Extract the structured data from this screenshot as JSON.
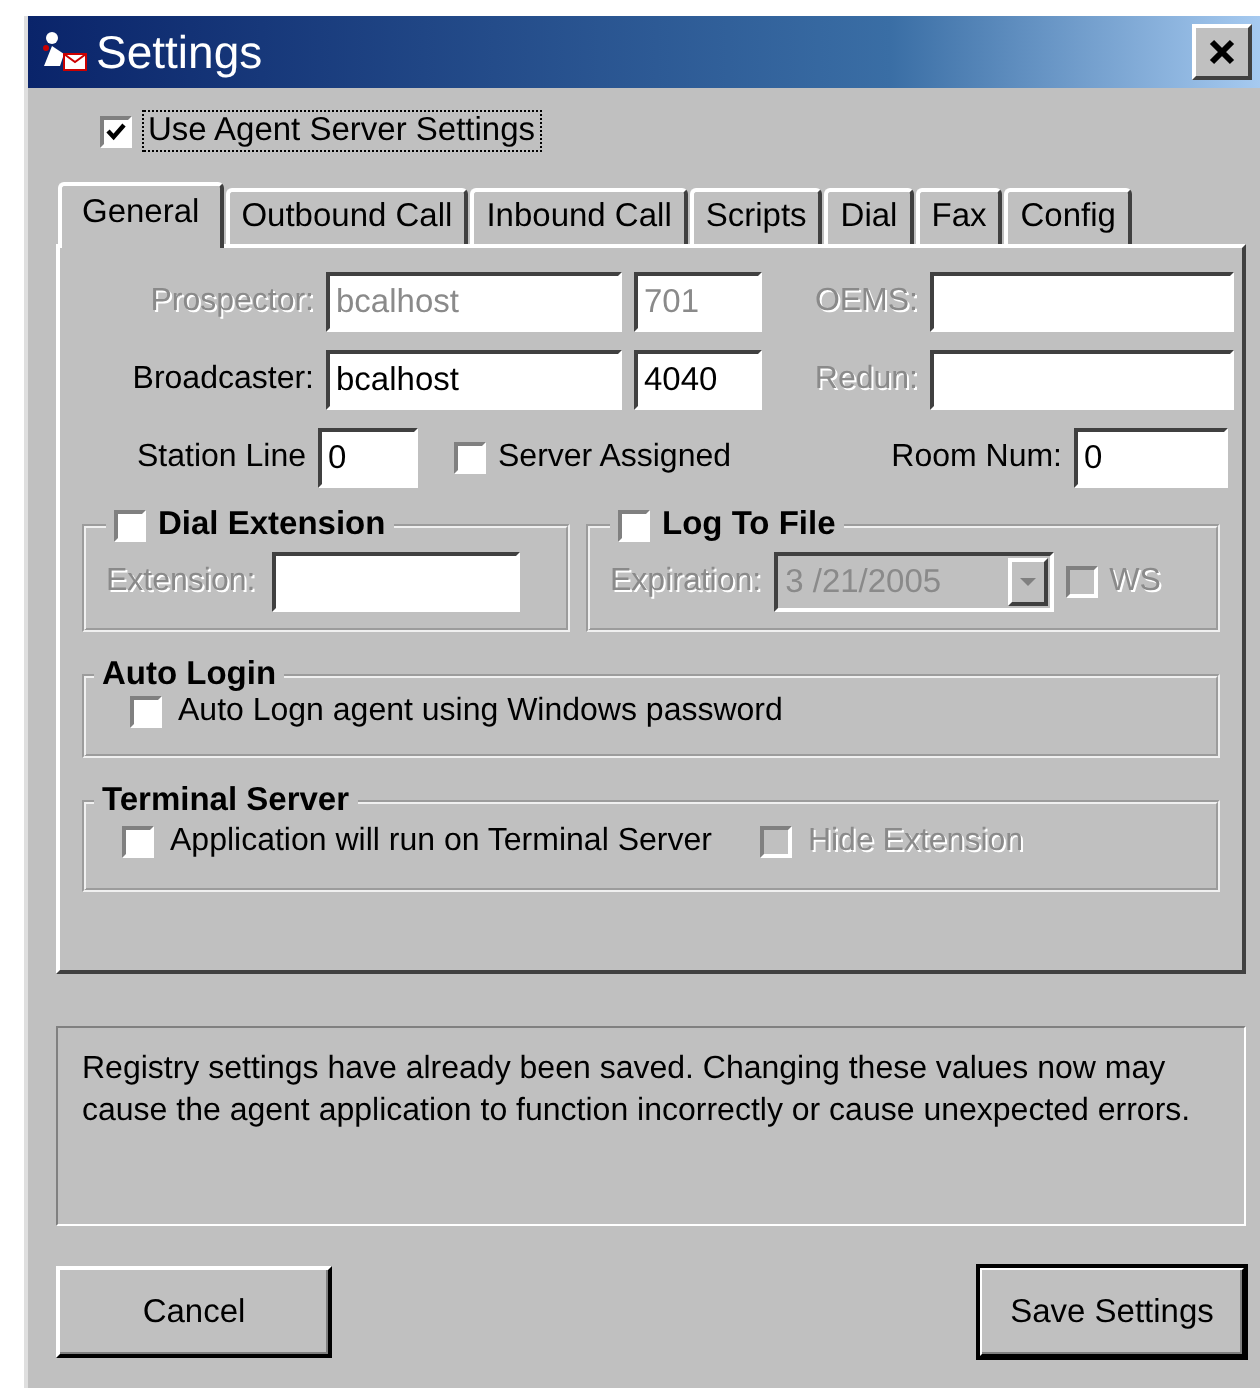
{
  "window": {
    "title": "Settings"
  },
  "use_server_settings": {
    "label": "Use Agent Server Settings",
    "checked": true
  },
  "tabs": [
    {
      "label": "General",
      "selected": true
    },
    {
      "label": "Outbound Call",
      "selected": false
    },
    {
      "label": "Inbound Call",
      "selected": false
    },
    {
      "label": "Scripts",
      "selected": false
    },
    {
      "label": "Dial",
      "selected": false
    },
    {
      "label": "Fax",
      "selected": false
    },
    {
      "label": "Config",
      "selected": false
    }
  ],
  "server_rows": [
    {
      "label": "Prospector:",
      "host": "bcalhost",
      "port": "701",
      "extra_label": "OEMS:",
      "disabled": true,
      "extra_disabled": true
    },
    {
      "label": "Broadcaster:",
      "host": "bcalhost",
      "port": "4040",
      "extra_label": "Redun:",
      "disabled": false,
      "extra_disabled": true
    }
  ],
  "station_line": {
    "label": "Station Line",
    "value": "0"
  },
  "server_assigned": {
    "label": "Server Assigned",
    "checked": false
  },
  "room_num": {
    "label": "Room Num:",
    "value": "0"
  },
  "dial_extension": {
    "title": "Dial Extension",
    "checked": false,
    "field_label": "Extension:",
    "disabled": true
  },
  "log_to_file": {
    "title": "Log To File",
    "checked": false,
    "field_label": "Expiration:",
    "date": "3 /21/2005",
    "ws_label": "WS",
    "ws_checked": false,
    "disabled": true
  },
  "auto_login": {
    "title": "Auto Login",
    "option": {
      "label": "Auto Logn agent using Windows password",
      "checked": false
    }
  },
  "terminal_server": {
    "title": "Terminal Server",
    "options": [
      {
        "label": "Application will run on Terminal Server",
        "checked": false,
        "disabled": false
      },
      {
        "label": "Hide Extension",
        "checked": false,
        "disabled": true
      }
    ]
  },
  "message": "Registry settings have already been saved. Changing these values now may cause the agent application to function incorrectly or cause unexpected errors.",
  "buttons": [
    {
      "label": "Cancel",
      "default": false
    },
    {
      "label": "Save Settings",
      "default": true
    }
  ]
}
